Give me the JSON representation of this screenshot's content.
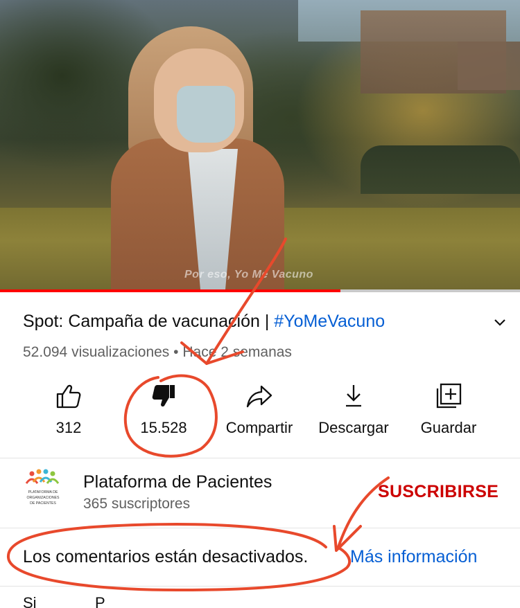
{
  "video": {
    "caption": "Por eso, Yo Me Vacuno",
    "progress_fraction": 0.655
  },
  "title": {
    "text": "Spot: Campaña de vacunación | ",
    "hashtag": "#YoMeVacuno"
  },
  "meta": {
    "views": "52.094 visualizaciones",
    "separator": " • ",
    "age": "Hace 2 semanas"
  },
  "actions": {
    "like_count": "312",
    "dislike_count": "15.528",
    "share_label": "Compartir",
    "download_label": "Descargar",
    "save_label": "Guardar"
  },
  "channel": {
    "name": "Plataforma de Pacientes",
    "subscribers": "365 suscriptores",
    "subscribe_label": "SUSCRIBIRSE",
    "logo_text": "PLATAFORMA DE ORGANIZACIONES DE PACIENTES"
  },
  "comments": {
    "disabled_text": "Los comentarios están desactivados.",
    "more_info_label": "Más información"
  },
  "next_row": {
    "left": "Si",
    "right": "P"
  },
  "colors": {
    "progress_red": "#ff0000",
    "link_blue": "#065fd4",
    "subscribe_red": "#cc0000",
    "annotation_red": "#e8492c"
  },
  "icons": [
    "like-icon",
    "dislike-icon",
    "share-icon",
    "download-icon",
    "save-icon",
    "chevron-down-icon"
  ]
}
